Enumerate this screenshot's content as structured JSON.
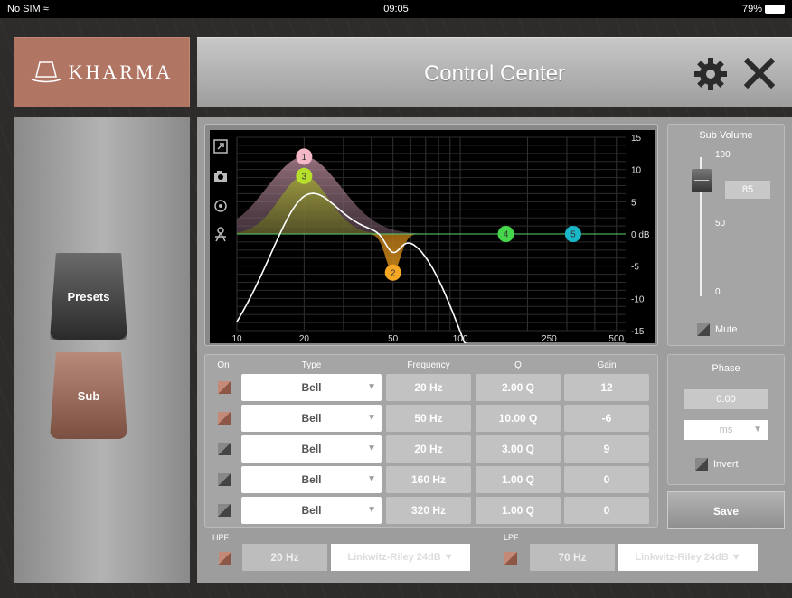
{
  "status_bar": {
    "carrier": "No SIM",
    "time": "09:05",
    "battery": "79%"
  },
  "logo": {
    "text": "KHARMA"
  },
  "header": {
    "title": "Control Center",
    "settings_icon": "gear-icon",
    "close_icon": "close-icon"
  },
  "side_nav": {
    "presets_label": "Presets",
    "sub_label": "Sub"
  },
  "graph": {
    "y_ticks": [
      "15",
      "10",
      "5",
      "0 dB",
      "-5",
      "-10",
      "-15"
    ],
    "x_ticks": [
      "10",
      "20",
      "50",
      "100",
      "250",
      "500"
    ],
    "tools": [
      "expand-icon",
      "camera-icon",
      "target-icon",
      "compass-icon"
    ],
    "markers": [
      {
        "label": "1",
        "freq": 20,
        "gain": 12,
        "color": "#f2b8c6"
      },
      {
        "label": "2",
        "freq": 50,
        "gain": -6,
        "color": "#f5a623"
      },
      {
        "label": "3",
        "freq": 20,
        "gain": 9,
        "color": "#b6e02c"
      },
      {
        "label": "4",
        "freq": 160,
        "gain": 0,
        "color": "#45d64b"
      },
      {
        "label": "5",
        "freq": 320,
        "gain": 0,
        "color": "#19b6c8"
      }
    ]
  },
  "sub_volume": {
    "title": "Sub Volume",
    "value": "85",
    "max_label": "100",
    "mid_label": "50",
    "min_label": "0",
    "mute_label": "Mute",
    "level_fraction": 0.85
  },
  "table": {
    "headers": {
      "on": "On",
      "type": "Type",
      "frequency": "Frequency",
      "q": "Q",
      "gain": "Gain"
    },
    "rows": [
      {
        "on": true,
        "type": "Bell",
        "frequency": "20 Hz",
        "q": "2.00 Q",
        "gain": "12"
      },
      {
        "on": true,
        "type": "Bell",
        "frequency": "50 Hz",
        "q": "10.00 Q",
        "gain": "-6"
      },
      {
        "on": false,
        "type": "Bell",
        "frequency": "20 Hz",
        "q": "3.00 Q",
        "gain": "9"
      },
      {
        "on": false,
        "type": "Bell",
        "frequency": "160 Hz",
        "q": "1.00 Q",
        "gain": "0"
      },
      {
        "on": false,
        "type": "Bell",
        "frequency": "320 Hz",
        "q": "1.00 Q",
        "gain": "0"
      }
    ]
  },
  "phase": {
    "title": "Phase",
    "value": "0.00",
    "unit": "ms",
    "invert_label": "Invert"
  },
  "save_label": "Save",
  "filters": {
    "hpf": {
      "label": "HPF",
      "frequency": "20 Hz",
      "type": "Linkwitz-Riley 24dB"
    },
    "lpf": {
      "label": "LPF",
      "frequency": "70 Hz",
      "type": "Linkwitz-Riley 24dB"
    }
  },
  "colors": {
    "accent": "#b07563",
    "panel": "#9d9d9d",
    "graph_bg": "#000000"
  }
}
